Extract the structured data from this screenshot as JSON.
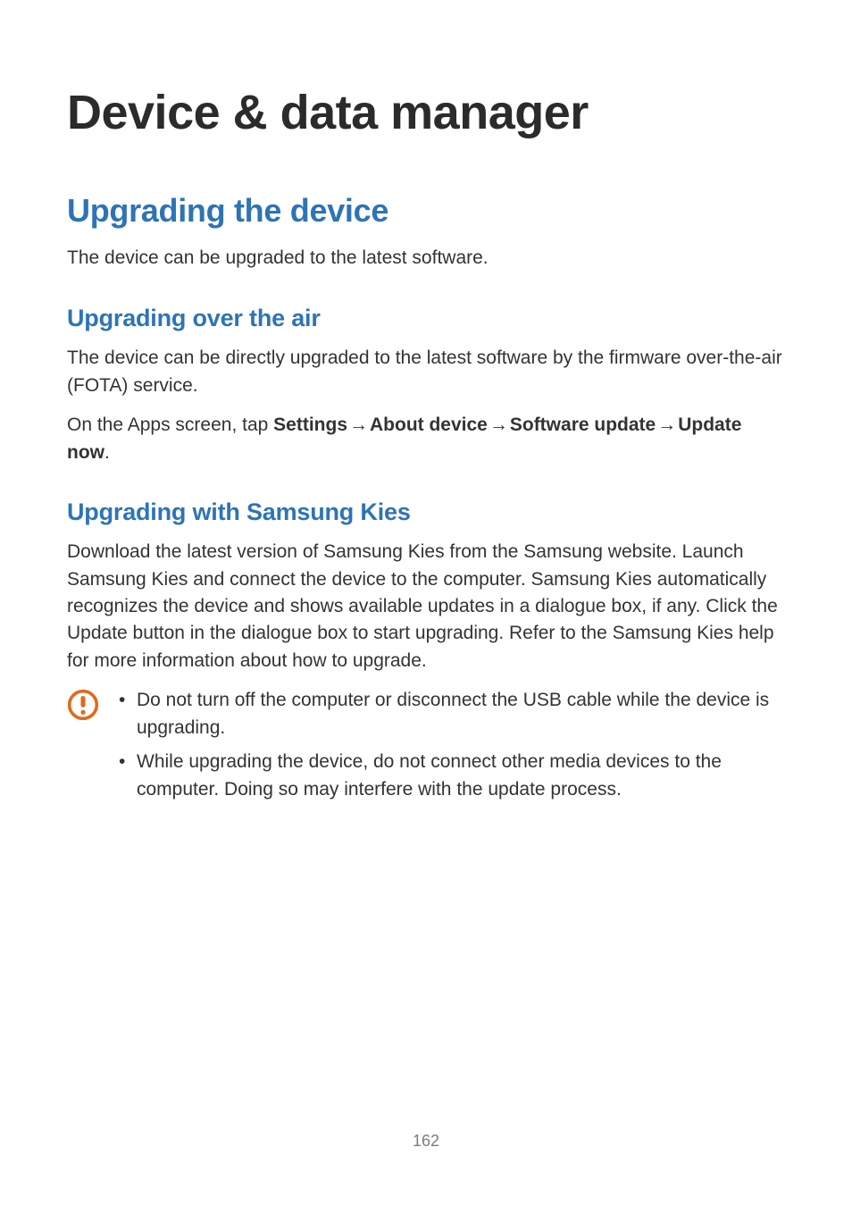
{
  "page_number": "162",
  "title": "Device & data manager",
  "section1": {
    "heading": "Upgrading the device",
    "intro": "The device can be upgraded to the latest software."
  },
  "sub1": {
    "heading": "Upgrading over the air",
    "p1": "The device can be directly upgraded to the latest software by the firmware over-the-air (FOTA) service.",
    "p2_pre": "On the Apps screen, tap ",
    "p2_b1": "Settings",
    "p2_b2": "About device",
    "p2_b3": "Software update",
    "p2_b4": "Update now",
    "p2_post": "."
  },
  "sub2": {
    "heading": "Upgrading with Samsung Kies",
    "p1": "Download the latest version of Samsung Kies from the Samsung website. Launch Samsung Kies and connect the device to the computer. Samsung Kies automatically recognizes the device and shows available updates in a dialogue box, if any. Click the Update button in the dialogue box to start upgrading. Refer to the Samsung Kies help for more information about how to upgrade."
  },
  "notice": {
    "icon_name": "caution-icon",
    "items": [
      "Do not turn off the computer or disconnect the USB cable while the device is upgrading.",
      "While upgrading the device, do not connect other media devices to the computer. Doing so may interfere with the update process."
    ]
  },
  "arrow_glyph": "→"
}
